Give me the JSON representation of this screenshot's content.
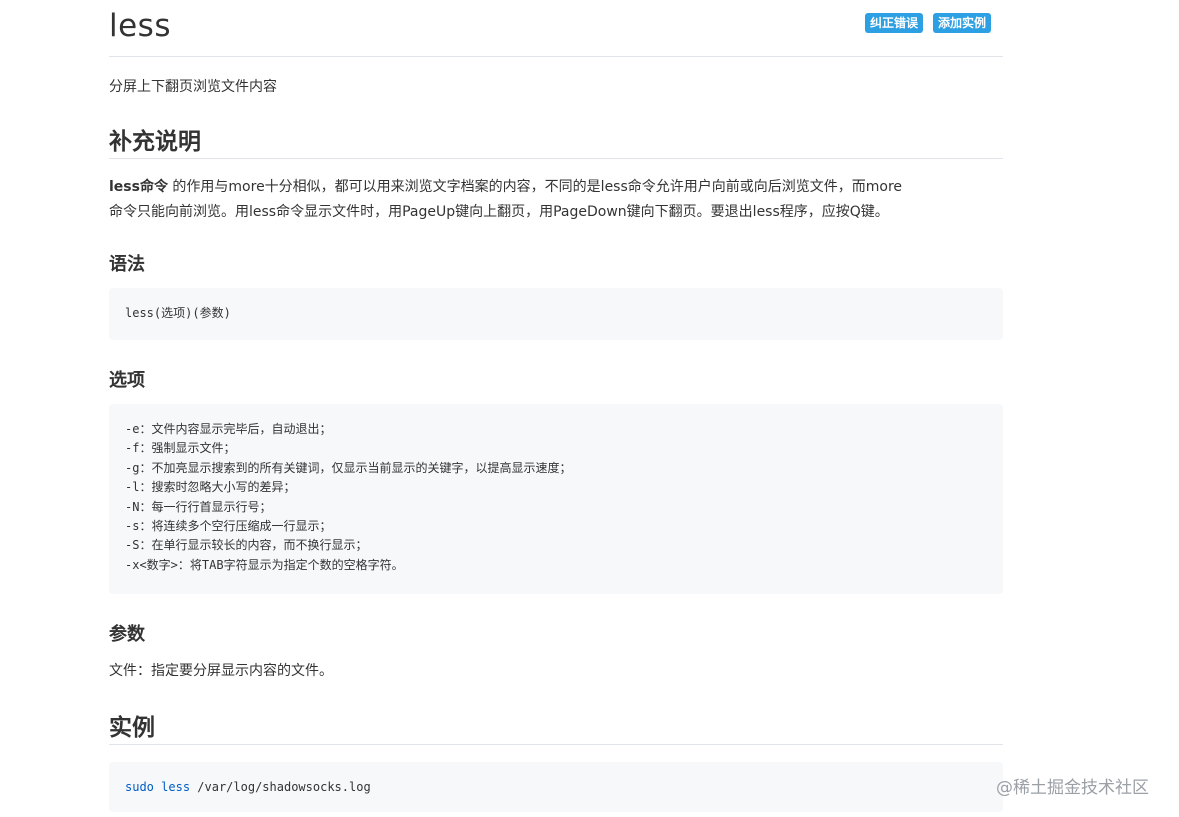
{
  "title": "less",
  "actions": {
    "correct_error": "纠正错误",
    "add_example": "添加实例"
  },
  "description": "分屏上下翻页浏览文件内容",
  "supplement": {
    "heading": "补充说明",
    "bold_lead": "less命令",
    "line1_rest": " 的作用与more十分相似，都可以用来浏览文字档案的内容，不同的是less命令允许用户向前或向后浏览文件，而more",
    "line2": "命令只能向前浏览。用less命令显示文件时，用PageUp键向上翻页，用PageDown键向下翻页。要退出less程序，应按Q键。"
  },
  "syntax": {
    "heading": "语法",
    "code": "less(选项)(参数)"
  },
  "options": {
    "heading": "选项",
    "lines": [
      "-e：文件内容显示完毕后，自动退出；",
      "-f：强制显示文件；",
      "-g：不加亮显示搜索到的所有关键词，仅显示当前显示的关键字，以提高显示速度；",
      "-l：搜索时忽略大小写的差异；",
      "-N：每一行行首显示行号；",
      "-s：将连续多个空行压缩成一行显示；",
      "-S：在单行显示较长的内容，而不换行显示；",
      "-x<数字>：将TAB字符显示为指定个数的空格字符。"
    ]
  },
  "params": {
    "heading": "参数",
    "text": "文件：指定要分屏显示内容的文件。"
  },
  "examples": {
    "heading": "实例",
    "cmd": "sudo",
    "cmd2": "less",
    "arg": " /var/log/shadowsocks.log"
  },
  "watermark": "@稀土掘金技术社区",
  "colors": {
    "badge": "#2d9fe3",
    "code_bg": "#f6f8fa",
    "keyword": "#005cc5"
  }
}
